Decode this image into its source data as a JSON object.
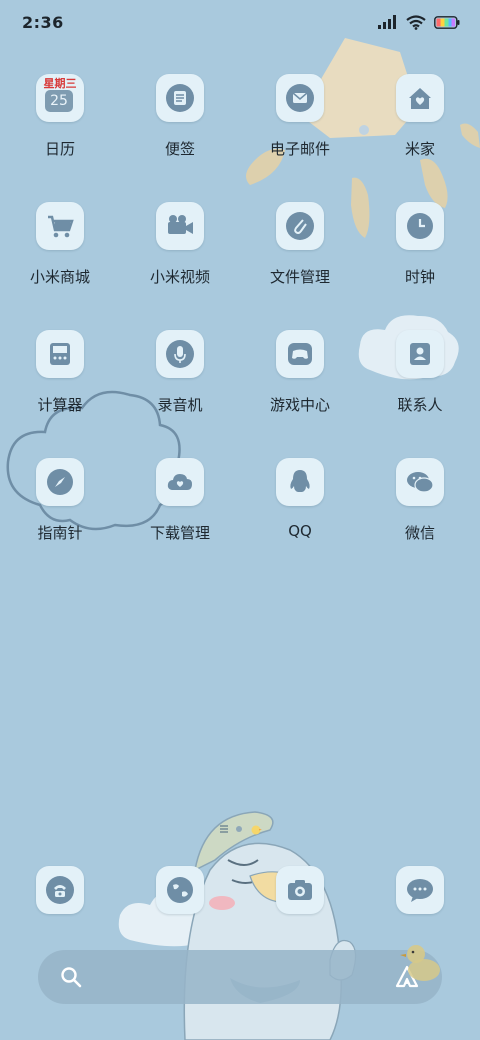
{
  "status_bar": {
    "time": "2:36"
  },
  "apps": {
    "row1": [
      {
        "label": "日历",
        "icon": "calendar-icon",
        "cal_weekday": "星期三",
        "cal_day": "25"
      },
      {
        "label": "便签",
        "icon": "notes-icon"
      },
      {
        "label": "电子邮件",
        "icon": "mail-icon"
      },
      {
        "label": "米家",
        "icon": "home-heart-icon"
      }
    ],
    "row2": [
      {
        "label": "小米商城",
        "icon": "cart-icon"
      },
      {
        "label": "小米视频",
        "icon": "video-camera-icon"
      },
      {
        "label": "文件管理",
        "icon": "paperclip-icon"
      },
      {
        "label": "时钟",
        "icon": "clock-icon"
      }
    ],
    "row3": [
      {
        "label": "计算器",
        "icon": "calculator-icon"
      },
      {
        "label": "录音机",
        "icon": "microphone-icon"
      },
      {
        "label": "游戏中心",
        "icon": "gamepad-icon"
      },
      {
        "label": "联系人",
        "icon": "contact-card-icon"
      }
    ],
    "row4": [
      {
        "label": "指南针",
        "icon": "compass-icon"
      },
      {
        "label": "下载管理",
        "icon": "cloud-heart-icon"
      },
      {
        "label": "QQ",
        "icon": "penguin-icon"
      },
      {
        "label": "微信",
        "icon": "wechat-bubbles-icon"
      }
    ]
  },
  "dock": [
    {
      "icon": "phone-icon"
    },
    {
      "icon": "globe-icon"
    },
    {
      "icon": "camera-icon"
    },
    {
      "icon": "message-bubble-icon"
    }
  ],
  "colors": {
    "background": "#a9c9dd",
    "icon_glyph": "#6f8ea6",
    "tile": "#e3f1f8"
  }
}
